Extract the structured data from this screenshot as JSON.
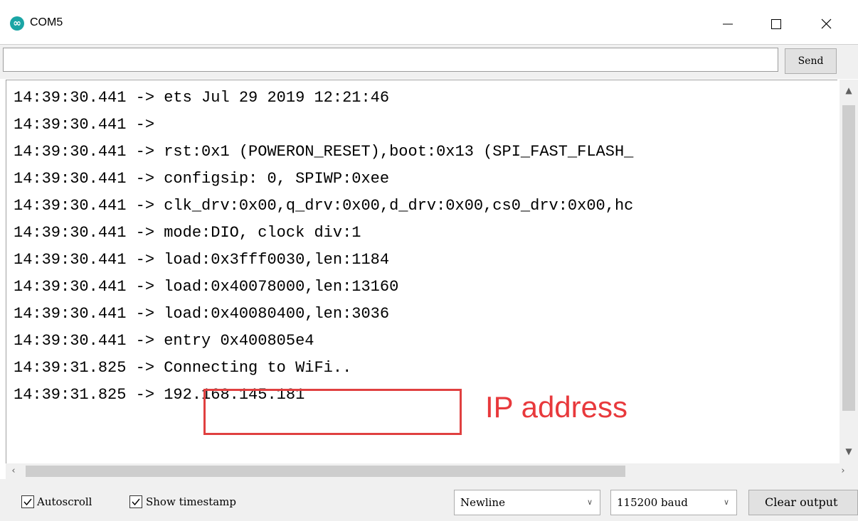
{
  "window": {
    "title": "COM5",
    "icon": "arduino-infinity-icon"
  },
  "input": {
    "value": "",
    "send_label": "Send"
  },
  "output": {
    "lines": [
      "14:39:30.441 -> ets Jul 29 2019 12:21:46",
      "14:39:30.441 -> ",
      "14:39:30.441 -> rst:0x1 (POWERON_RESET),boot:0x13 (SPI_FAST_FLASH_",
      "14:39:30.441 -> configsip: 0, SPIWP:0xee",
      "14:39:30.441 -> clk_drv:0x00,q_drv:0x00,d_drv:0x00,cs0_drv:0x00,hc",
      "14:39:30.441 -> mode:DIO, clock div:1",
      "14:39:30.441 -> load:0x3fff0030,len:1184",
      "14:39:30.441 -> load:0x40078000,len:13160",
      "14:39:30.441 -> load:0x40080400,len:3036",
      "14:39:30.441 -> entry 0x400805e4",
      "14:39:31.825 -> Connecting to WiFi..",
      "14:39:31.825 -> 192.168.145.181"
    ]
  },
  "annotation": {
    "label": "IP address",
    "color": "#e8393c"
  },
  "bottom": {
    "autoscroll_label": "Autoscroll",
    "autoscroll_checked": true,
    "timestamp_label": "Show timestamp",
    "timestamp_checked": true,
    "line_ending": "Newline",
    "baud_rate": "115200 baud",
    "clear_label": "Clear output"
  }
}
